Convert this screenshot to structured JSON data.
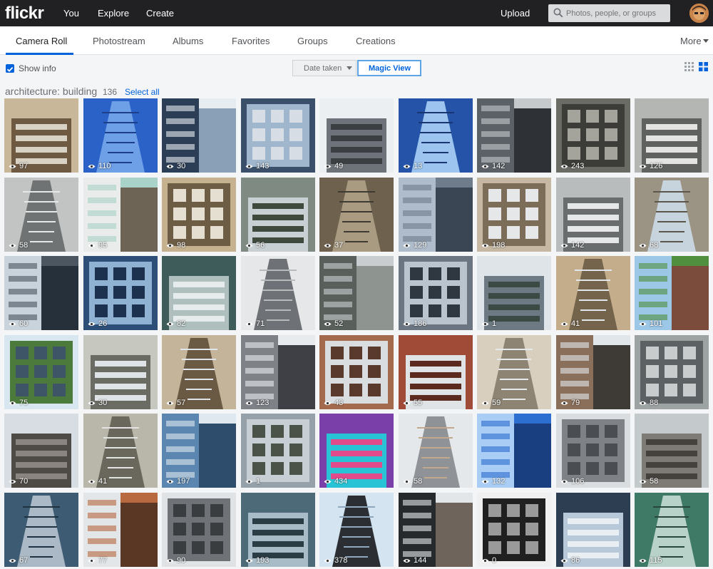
{
  "header": {
    "logo": "flickr",
    "nav": [
      "You",
      "Explore",
      "Create"
    ],
    "upload": "Upload",
    "search_placeholder": "Photos, people, or groups"
  },
  "tabs": [
    {
      "label": "Camera Roll",
      "active": true
    },
    {
      "label": "Photostream",
      "active": false
    },
    {
      "label": "Albums",
      "active": false
    },
    {
      "label": "Favorites",
      "active": false
    },
    {
      "label": "Groups",
      "active": false
    },
    {
      "label": "Creations",
      "active": false
    }
  ],
  "more_label": "More",
  "toolbar": {
    "show_info_label": "Show info",
    "show_info_checked": true,
    "sort_label": "Date taken",
    "magic_view_label": "Magic View"
  },
  "gallery": {
    "title": "architecture: building",
    "count": "136",
    "select_all": "Select all"
  },
  "colors": {
    "accent": "#0063dc",
    "topbar": "#212124"
  },
  "photos": [
    {
      "views": "97",
      "colors": [
        "#c9b79a",
        "#6e5a43",
        "#d8d2c4"
      ]
    },
    {
      "views": "110",
      "colors": [
        "#2a62c8",
        "#6ea0e8",
        "#1d3f8a"
      ]
    },
    {
      "views": "30",
      "colors": [
        "#e7ecf1",
        "#2c3e55",
        "#8aa0b6"
      ]
    },
    {
      "views": "143",
      "colors": [
        "#3a4f6a",
        "#9fb6cc",
        "#d6dde4"
      ]
    },
    {
      "views": "49",
      "colors": [
        "#eceff1",
        "#6d7378",
        "#3b3f42"
      ]
    },
    {
      "views": "13",
      "colors": [
        "#2453a8",
        "#9cc4ee",
        "#1a3670"
      ]
    },
    {
      "views": "142",
      "colors": [
        "#c5c9cc",
        "#5b6166",
        "#2e3236"
      ]
    },
    {
      "views": "243",
      "colors": [
        "#6b6b66",
        "#3c3c38",
        "#a5a49c"
      ]
    },
    {
      "views": "126",
      "colors": [
        "#b4b6b3",
        "#5f625f",
        "#e3e4e2"
      ]
    },
    {
      "views": "58",
      "colors": [
        "#c2c4c4",
        "#6f7373",
        "#e6e8e8"
      ]
    },
    {
      "views": "95",
      "colors": [
        "#a9d3c8",
        "#e9ecea",
        "#6d6456"
      ]
    },
    {
      "views": "98",
      "colors": [
        "#c7b28f",
        "#6e5d45",
        "#e5dfd2"
      ]
    },
    {
      "views": "56",
      "colors": [
        "#7f8b82",
        "#c9d0d3",
        "#3f4a3e"
      ]
    },
    {
      "views": "37",
      "colors": [
        "#6e624e",
        "#a89b82",
        "#3f3a31"
      ]
    },
    {
      "views": "129",
      "colors": [
        "#6e7c8c",
        "#aebccc",
        "#3b4654"
      ]
    },
    {
      "views": "198",
      "colors": [
        "#c6b8a3",
        "#7b6d58",
        "#e5e7e9"
      ]
    },
    {
      "views": "142",
      "colors": [
        "#b9bcbd",
        "#6a6d6e",
        "#e5e7e8"
      ]
    },
    {
      "views": "68",
      "colors": [
        "#9b9484",
        "#c8d4dd",
        "#5b564b"
      ]
    },
    {
      "views": "60",
      "colors": [
        "#4b5661",
        "#c8d3db",
        "#26303a"
      ]
    },
    {
      "views": "26",
      "colors": [
        "#2d4f77",
        "#8fb1d2",
        "#1b314d"
      ]
    },
    {
      "views": "82",
      "colors": [
        "#3d5c5a",
        "#aebfbe",
        "#e6ebeb"
      ]
    },
    {
      "views": "71",
      "colors": [
        "#e6e7e8",
        "#6e7175",
        "#b7b9bb"
      ]
    },
    {
      "views": "52",
      "colors": [
        "#c9cdd0",
        "#59605b",
        "#8e9590"
      ]
    },
    {
      "views": "186",
      "colors": [
        "#6c7682",
        "#b9c4cf",
        "#2f3741"
      ]
    },
    {
      "views": "1",
      "colors": [
        "#dfe4e8",
        "#6d7a84",
        "#3c4a45"
      ]
    },
    {
      "views": "41",
      "colors": [
        "#c3ad8b",
        "#75644c",
        "#e0e6ec"
      ]
    },
    {
      "views": "101",
      "colors": [
        "#4f8f3e",
        "#9cc7e6",
        "#7b4b3c"
      ]
    },
    {
      "views": "75",
      "colors": [
        "#d8e6ef",
        "#4c7a3c",
        "#3e5568"
      ]
    },
    {
      "views": "30",
      "colors": [
        "#c6c7bf",
        "#6a6b63",
        "#dfe3e5"
      ]
    },
    {
      "views": "57",
      "colors": [
        "#c4b49a",
        "#6a5a44",
        "#dfe5ea"
      ]
    },
    {
      "views": "123",
      "colors": [
        "#e7ebee",
        "#7e8186",
        "#3e4045"
      ]
    },
    {
      "views": "43",
      "colors": [
        "#a36a4d",
        "#d9dde0",
        "#5a3a2c"
      ]
    },
    {
      "views": "55",
      "colors": [
        "#a04b38",
        "#dfe3e6",
        "#5d2a20"
      ]
    },
    {
      "views": "59",
      "colors": [
        "#d8cfbf",
        "#8d8474",
        "#e6e9eb"
      ]
    },
    {
      "views": "79",
      "colors": [
        "#e1e6ea",
        "#8a6f5a",
        "#3e3a36"
      ]
    },
    {
      "views": "88",
      "colors": [
        "#9da2a3",
        "#5c6163",
        "#c9cccd"
      ]
    },
    {
      "views": "70",
      "colors": [
        "#d7dde2",
        "#4e4b47",
        "#8a8580"
      ]
    },
    {
      "views": "41",
      "colors": [
        "#b9b7a9",
        "#6a685c",
        "#e2e4e3"
      ]
    },
    {
      "views": "197",
      "colors": [
        "#dfe7ef",
        "#5a86b0",
        "#2e4c6c"
      ]
    },
    {
      "views": "1",
      "colors": [
        "#96a0a8",
        "#c7ced4",
        "#4b5248"
      ]
    },
    {
      "views": "434",
      "colors": [
        "#7a3fa8",
        "#28c4d6",
        "#e14a8b"
      ]
    },
    {
      "views": "58",
      "colors": [
        "#e5e8ea",
        "#8f9397",
        "#c2a98e"
      ]
    },
    {
      "views": "132",
      "colors": [
        "#2d6fd1",
        "#a9cdf4",
        "#193f80"
      ]
    },
    {
      "views": "106",
      "colors": [
        "#d9dde0",
        "#7e8286",
        "#4a4e52"
      ]
    },
    {
      "views": "58",
      "colors": [
        "#c4c9cc",
        "#7e7b76",
        "#45413d"
      ]
    },
    {
      "views": "67",
      "colors": [
        "#3d5b73",
        "#aab9c5",
        "#1f3242"
      ]
    },
    {
      "views": "77",
      "colors": [
        "#b8693f",
        "#e3e6e8",
        "#5a3624"
      ]
    },
    {
      "views": "90",
      "colors": [
        "#dfe3e6",
        "#6f7377",
        "#3a3d40"
      ]
    },
    {
      "views": "193",
      "colors": [
        "#4c6a78",
        "#a7bcc6",
        "#2a3c44"
      ]
    },
    {
      "views": "378",
      "colors": [
        "#d4e4f1",
        "#2b2f33",
        "#8fa8be"
      ]
    },
    {
      "views": "144",
      "colors": [
        "#e3e6e8",
        "#262a2d",
        "#6e645b"
      ]
    },
    {
      "views": "0",
      "colors": [
        "#f0f0f0",
        "#202020",
        "#9a9a9a"
      ]
    },
    {
      "views": "86",
      "colors": [
        "#2d3e52",
        "#b7c8d8",
        "#e9eef2"
      ]
    },
    {
      "views": "115",
      "colors": [
        "#3f7a66",
        "#b9d2c9",
        "#27473c"
      ]
    }
  ]
}
